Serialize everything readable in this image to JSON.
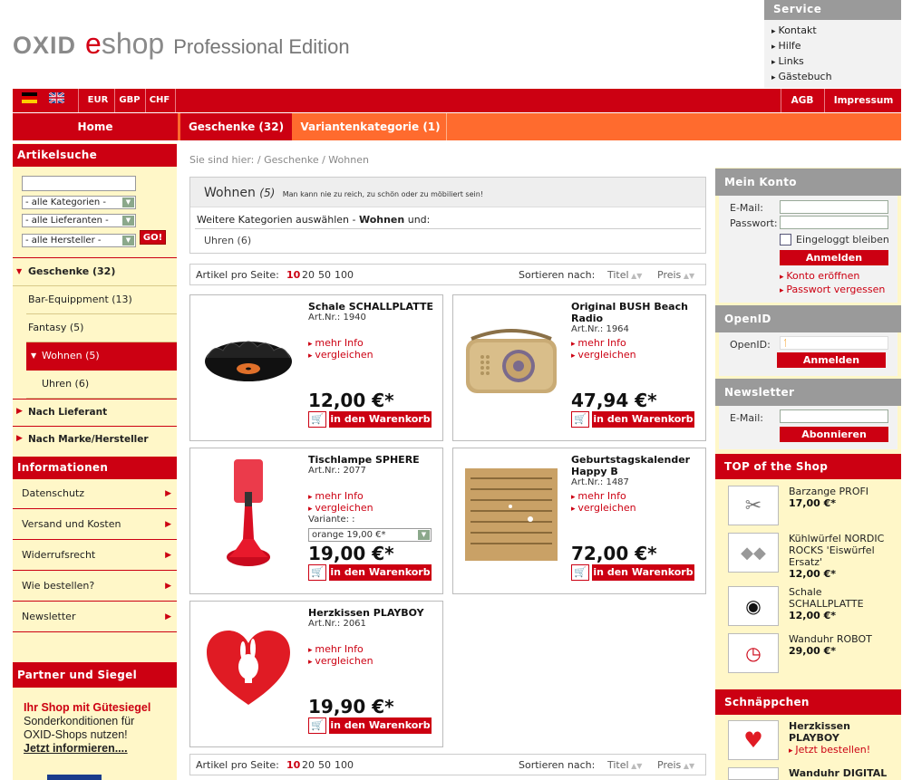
{
  "logo": {
    "oxid": "OXID",
    "e": "e",
    "shop": "shop",
    "edition": "Professional Edition"
  },
  "service": {
    "title": "Service",
    "items": [
      "Kontakt",
      "Hilfe",
      "Links",
      "Gästebuch"
    ]
  },
  "topbar": {
    "currencies": [
      "EUR",
      "GBP",
      "CHF"
    ],
    "links": [
      "AGB",
      "Impressum"
    ]
  },
  "nav": {
    "home": "Home",
    "cat1": "Geschenke (32)",
    "cat2": "Variantenkategorie (1)"
  },
  "left": {
    "search_title": "Artikelsuche",
    "selects": [
      "- alle Kategorien -",
      "- alle Lieferanten -",
      "- alle Hersteller -"
    ],
    "go": "GO!",
    "cats": {
      "geschenke": "Geschenke (32)",
      "bar": "Bar-Equippment (13)",
      "fantasy": "Fantasy (5)",
      "wohnen": "Wohnen (5)",
      "uhren": "Uhren (6)",
      "lieferant": "Nach Lieferant",
      "marke": "Nach Marke/Hersteller"
    },
    "info_title": "Informationen",
    "info": [
      "Datenschutz",
      "Versand und Kosten",
      "Widerrufsrecht",
      "Wie bestellen?",
      "Newsletter"
    ],
    "partner_title": "Partner und Siegel",
    "partner": {
      "line1": "Ihr Shop mit Gütesiegel",
      "line2": "Sonderkonditionen für",
      "line3": "OXID-Shops nutzen!",
      "link": "Jetzt informieren...."
    }
  },
  "center": {
    "breadcrumb": "Sie sind hier: / Geschenke / Wohnen",
    "heading": "Wohnen",
    "count": "(5)",
    "slogan": "Man kann nie zu reich, zu schön oder zu möbiliert sein!",
    "more_prefix": "Weitere Kategorien auswählen - ",
    "more_bold": "Wohnen",
    "more_suffix": " und:",
    "subcat": "Uhren (6)",
    "pager": {
      "label": "Artikel pro Seite:",
      "opts": [
        "10",
        "20",
        "50",
        "100"
      ],
      "sort_label": "Sortieren nach:",
      "sort_title": "Titel",
      "sort_price": "Preis"
    },
    "links": {
      "more": "mehr Info",
      "compare": "vergleichen",
      "cart": "in den Warenkorb"
    },
    "products": [
      {
        "title": "Schale SCHALLPLATTE",
        "artnr": "Art.Nr.: 1940",
        "price": "12,00 €*"
      },
      {
        "title": "Original BUSH Beach Radio",
        "artnr": "Art.Nr.: 1964",
        "price": "47,94 €*"
      },
      {
        "title": "Tischlampe SPHERE",
        "artnr": "Art.Nr.: 2077",
        "price": "19,00 €*",
        "variant_label": "Variante: :",
        "variant_value": "orange 19,00 €*"
      },
      {
        "title": "Geburtstagskalender Happy B",
        "artnr": "Art.Nr.: 1487",
        "price": "72,00 €*"
      },
      {
        "title": "Herzkissen PLAYBOY",
        "artnr": "Art.Nr.: 2061",
        "price": "19,90 €*"
      }
    ]
  },
  "right": {
    "konto": {
      "title": "Mein Konto",
      "email": "E-Mail:",
      "password": "Passwort:",
      "remember": "Eingeloggt bleiben",
      "login": "Anmelden",
      "register": "Konto eröffnen",
      "forgot": "Passwort vergessen"
    },
    "openid": {
      "title": "OpenID",
      "label": "OpenID:",
      "login": "Anmelden"
    },
    "newsletter": {
      "title": "Newsletter",
      "email": "E-Mail:",
      "subscribe": "Abonnieren"
    },
    "top": {
      "title": "TOP of the Shop",
      "items": [
        {
          "name": "Barzange PROFI",
          "price": "17,00 €*"
        },
        {
          "name": "Kühlwürfel NORDIC ROCKS 'Eiswürfel Ersatz'",
          "price": "12,00 €*"
        },
        {
          "name": "Schale SCHALLPLATTE",
          "price": "12,00 €*"
        },
        {
          "name": "Wanduhr ROBOT",
          "price": "29,00 €*"
        }
      ]
    },
    "bargain": {
      "title": "Schnäppchen",
      "items": [
        {
          "name": "Herzkissen PLAYBOY",
          "link": "Jetzt bestellen!"
        },
        {
          "name": "Wanduhr DIGITAL"
        }
      ]
    }
  },
  "colors": {
    "brand_red": "#cc0012",
    "nav_orange": "#ff6b2e",
    "sidebar_bg": "#fff7c8"
  }
}
